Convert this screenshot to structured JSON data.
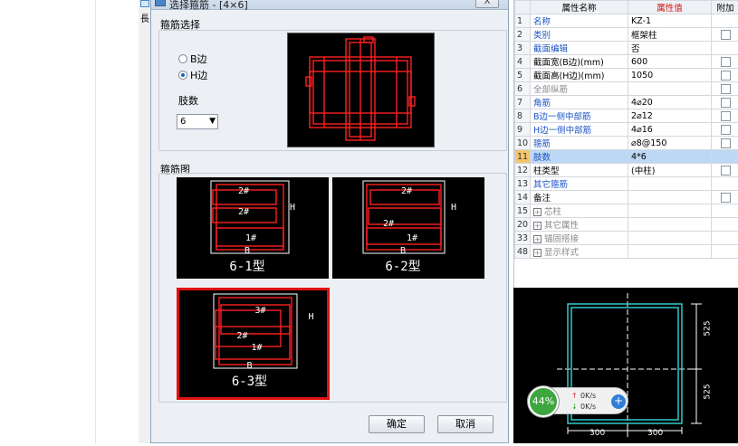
{
  "strip": {
    "text": "長"
  },
  "dialog": {
    "title": "选择箍筋 - [4×6]",
    "close": "X",
    "group_select_label": "箍筋选择",
    "radio_b": "B边",
    "radio_h": "H边",
    "selected_radio": "H边",
    "group_legs_label": "肢数",
    "legs_value": "6",
    "group_diagram_label": "箍筋图",
    "diagrams": [
      {
        "name": "6-1型",
        "tags": [
          "2#",
          "2#",
          "1#"
        ],
        "b": "B",
        "h": "H"
      },
      {
        "name": "6-2型",
        "tags": [
          "2#",
          "2#",
          "1#"
        ],
        "b": "B",
        "h": "H"
      },
      {
        "name": "6-3型",
        "tags": [
          "3#",
          "2#",
          "1#"
        ],
        "b": "B",
        "h": "H"
      }
    ],
    "ok": "确定",
    "cancel": "取消"
  },
  "table": {
    "headers": [
      "",
      "属性名称",
      "属性值",
      "附加"
    ],
    "rows": [
      {
        "num": "1",
        "name": "名称",
        "value": "KZ-1",
        "check": false,
        "style": "blue"
      },
      {
        "num": "2",
        "name": "类别",
        "value": "框架柱",
        "check": true,
        "style": "blue"
      },
      {
        "num": "3",
        "name": "截面编辑",
        "value": "否",
        "check": false,
        "style": "blue"
      },
      {
        "num": "4",
        "name": "截面宽(B边)(mm)",
        "value": "600",
        "check": true,
        "style": "black"
      },
      {
        "num": "5",
        "name": "截面高(H边)(mm)",
        "value": "1050",
        "check": true,
        "style": "black"
      },
      {
        "num": "6",
        "name": "全部纵筋",
        "value": "",
        "check": true,
        "style": "gray"
      },
      {
        "num": "7",
        "name": "角筋",
        "value": "4⌀20",
        "check": true,
        "style": "blue"
      },
      {
        "num": "8",
        "name": "B边一侧中部筋",
        "value": "2⌀12",
        "check": true,
        "style": "blue"
      },
      {
        "num": "9",
        "name": "H边一侧中部筋",
        "value": "4⌀16",
        "check": true,
        "style": "blue"
      },
      {
        "num": "10",
        "name": "箍筋",
        "value": "⌀8@150",
        "check": true,
        "style": "blue"
      },
      {
        "num": "11",
        "name": "肢数",
        "value": "4*6",
        "check": false,
        "style": "blue",
        "selected": true
      },
      {
        "num": "12",
        "name": "柱类型",
        "value": "(中柱)",
        "check": true,
        "style": "black"
      },
      {
        "num": "13",
        "name": "其它箍筋",
        "value": "",
        "check": false,
        "style": "blue"
      },
      {
        "num": "14",
        "name": "备注",
        "value": "",
        "check": true,
        "style": "black"
      },
      {
        "num": "15",
        "name": "芯柱",
        "value": "",
        "check": false,
        "style": "gray",
        "expand": true
      },
      {
        "num": "20",
        "name": "其它属性",
        "value": "",
        "check": false,
        "style": "gray",
        "expand": true
      },
      {
        "num": "33",
        "name": "锚固搭接",
        "value": "",
        "check": false,
        "style": "gray",
        "expand": true
      },
      {
        "num": "48",
        "name": "显示样式",
        "value": "",
        "check": false,
        "style": "gray",
        "expand": true
      }
    ]
  },
  "cad": {
    "dim_h1": "525",
    "dim_h2": "525",
    "dim_w1": "300",
    "dim_w2": "300"
  },
  "speed": {
    "percent": "44%",
    "up": "0K/s",
    "down": "0K/s",
    "badge": "+"
  }
}
